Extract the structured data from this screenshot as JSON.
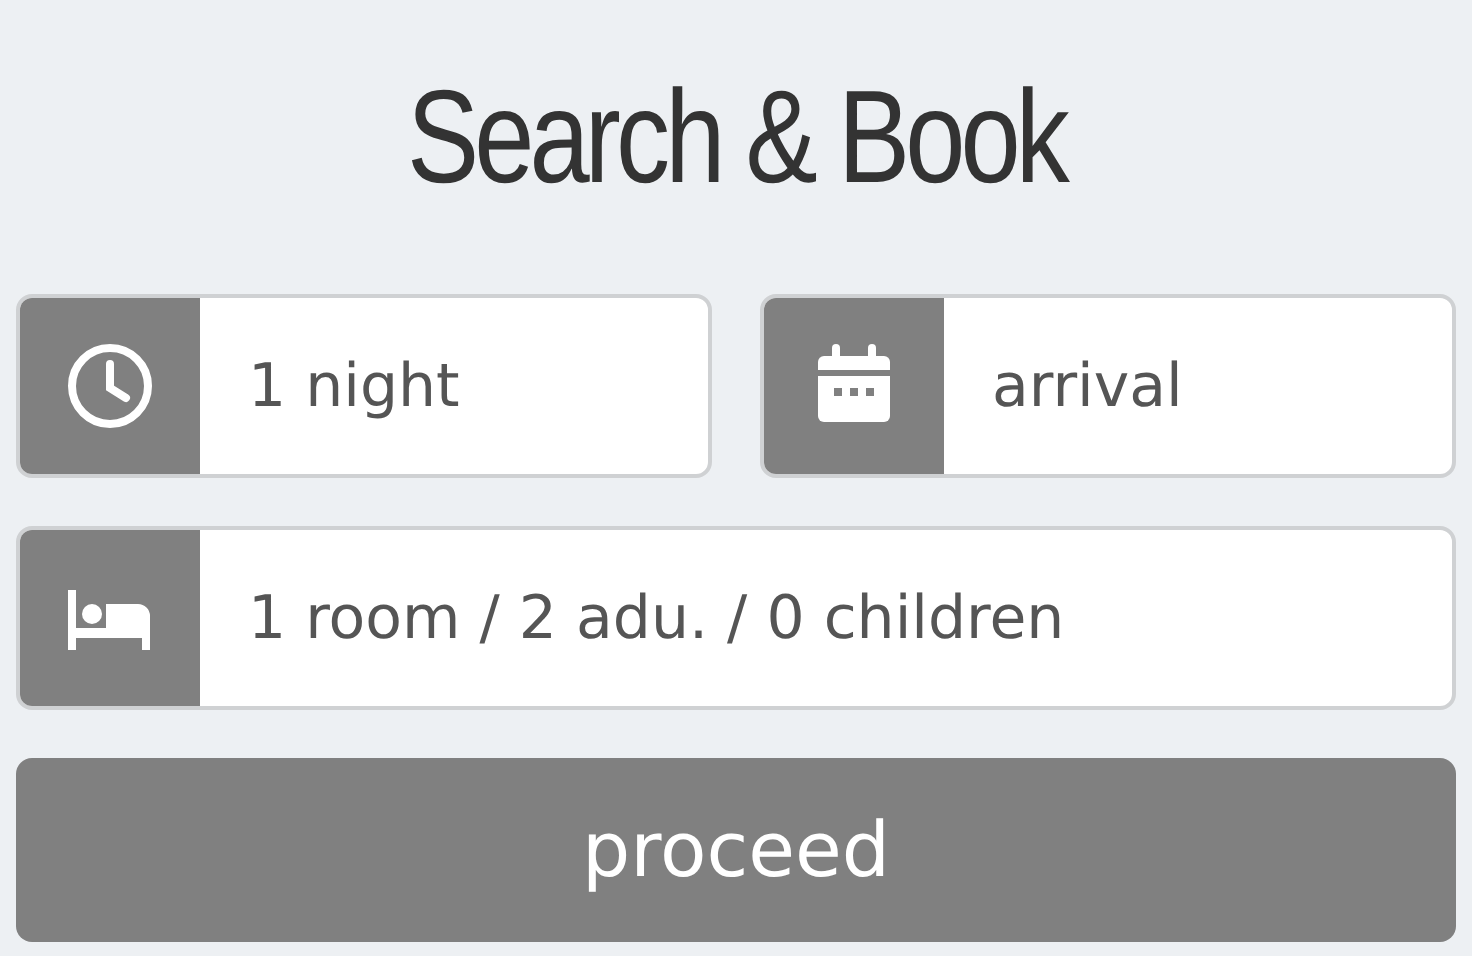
{
  "title": "Search & Book",
  "fields": [
    {
      "kind": "nights",
      "value": "1 night"
    },
    {
      "kind": "arrival",
      "placeholder": "arrival"
    },
    {
      "kind": "guests",
      "value": "1 room / 2 adu. / 0 children"
    }
  ],
  "button": "proceed"
}
